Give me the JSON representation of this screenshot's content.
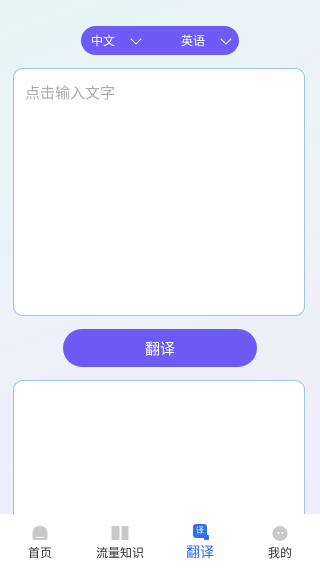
{
  "language_selector": {
    "source": "中文",
    "target": "英语"
  },
  "input": {
    "placeholder": "点击输入文字",
    "value": ""
  },
  "translate_button": "翻译",
  "output": {
    "text": ""
  },
  "tabbar": {
    "items": [
      {
        "label": "首页",
        "icon": "home-icon",
        "active": false
      },
      {
        "label": "流量知识",
        "icon": "book-icon",
        "active": false
      },
      {
        "label": "翻译",
        "icon": "translate-icon",
        "icon_text": "译",
        "active": true
      },
      {
        "label": "我的",
        "icon": "profile-icon",
        "active": false
      }
    ],
    "active_color": "#2d6ff0"
  },
  "colors": {
    "accent": "#6c5cf5",
    "box_border": "#9ec3ee"
  }
}
